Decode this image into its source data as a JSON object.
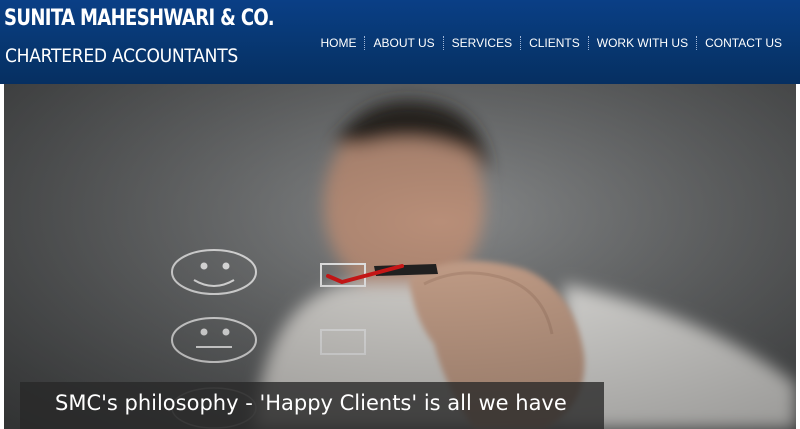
{
  "brand": {
    "name_line1": "SUNITA MAHESHWARI & CO.",
    "name_line2": "CHARTERED ACCOUNTANTS",
    "header_color": "#073a7a"
  },
  "nav": {
    "items": [
      {
        "label": "HOME"
      },
      {
        "label": "ABOUT US"
      },
      {
        "label": "SERVICES"
      },
      {
        "label": "CLIENTS"
      },
      {
        "label": "WORK WITH US"
      },
      {
        "label": "CONTACT US"
      }
    ]
  },
  "hero": {
    "image_icon": "hand-marking-smiley-checkbox-photo",
    "caption": "SMC's philosophy - 'Happy Clients' is all we have"
  }
}
